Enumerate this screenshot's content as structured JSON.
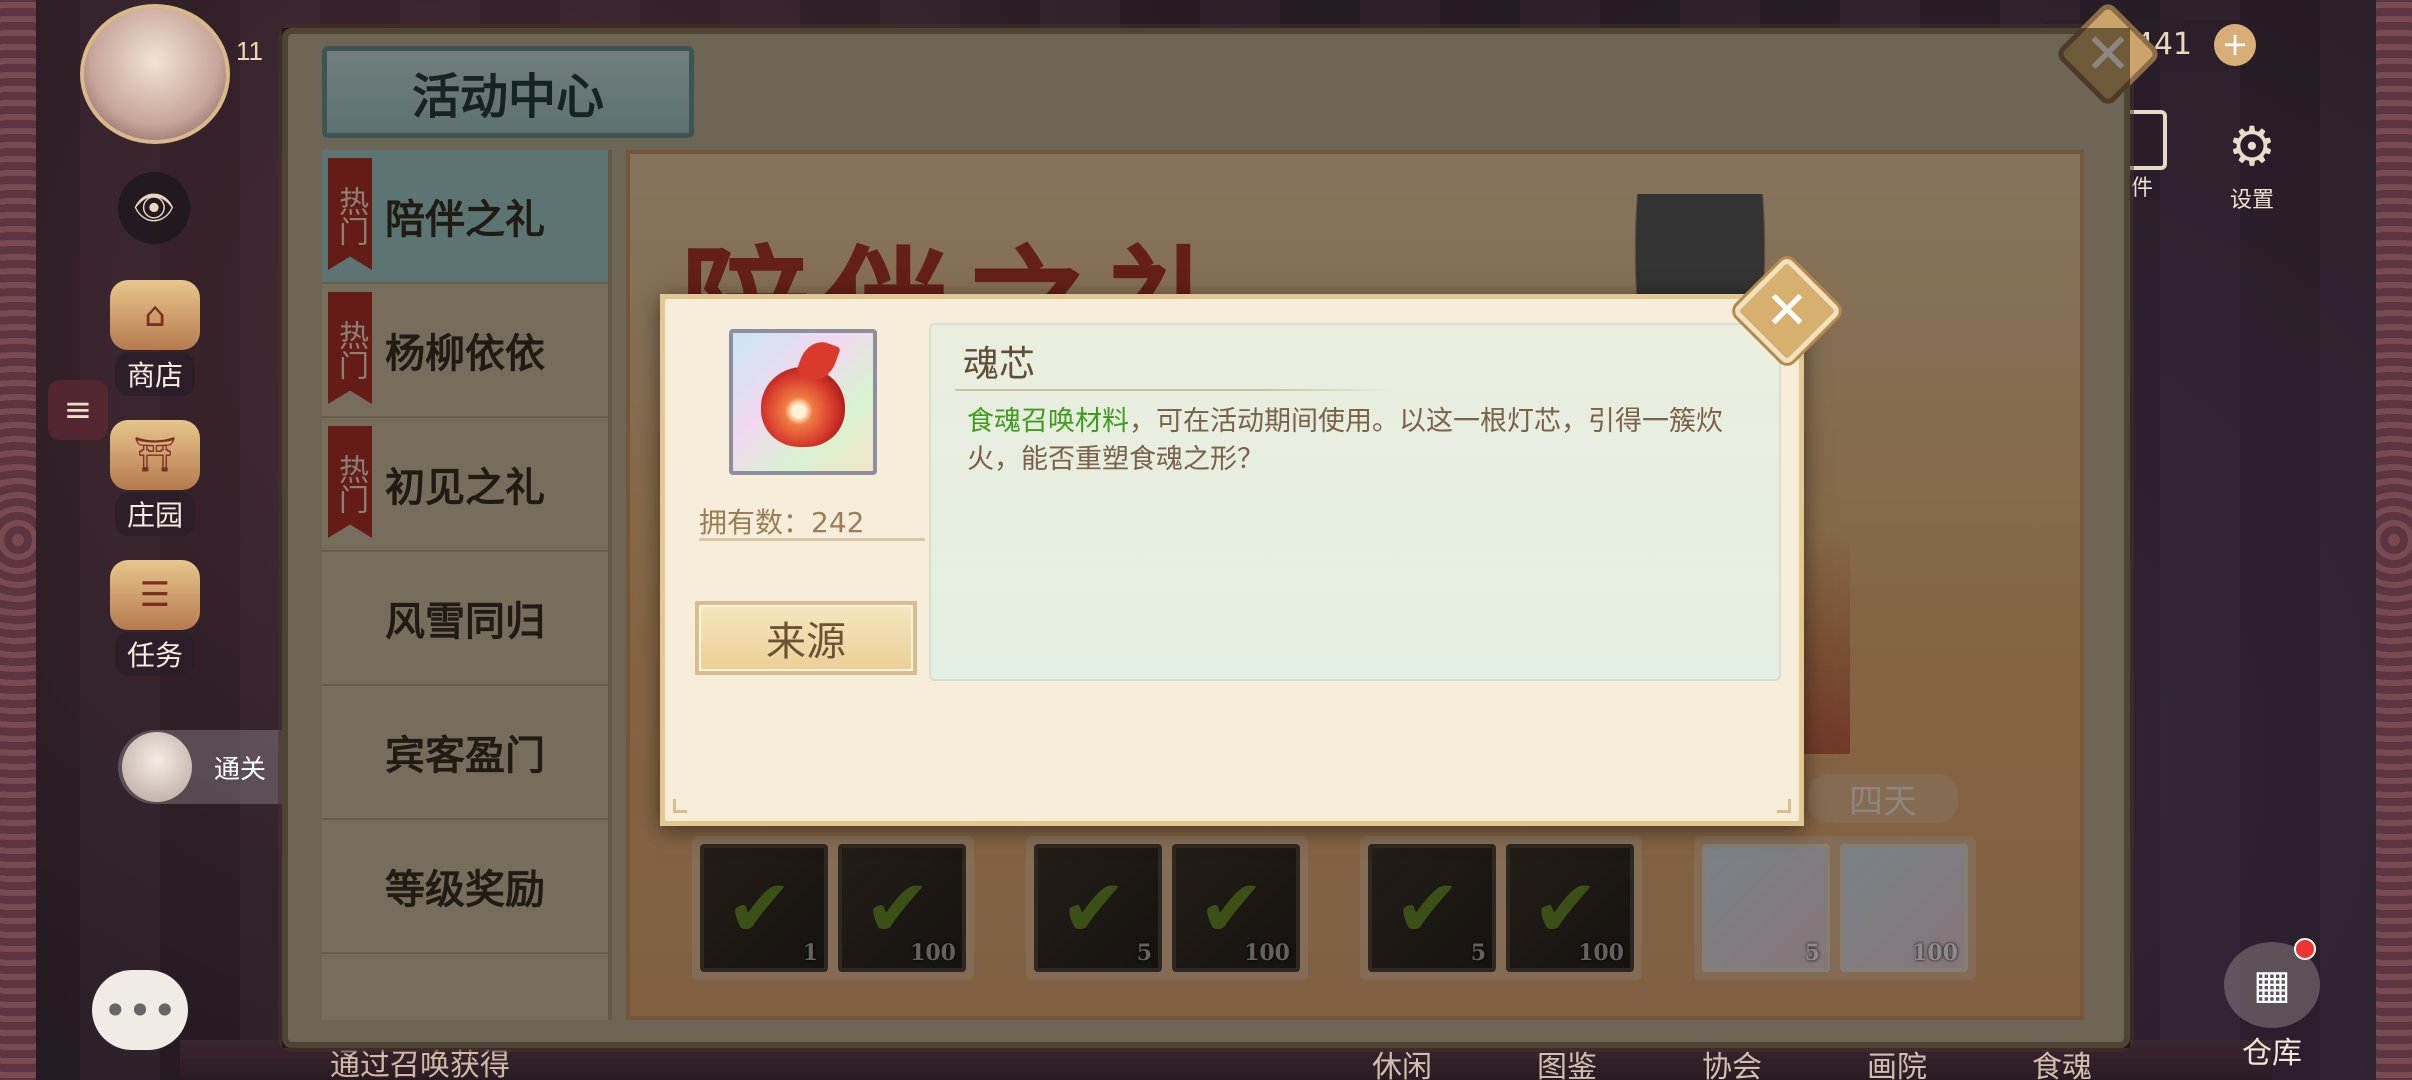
{
  "hud": {
    "level": "11",
    "resource_value": "441",
    "plus_symbol": "+",
    "settings_label": "设置",
    "mail_label": "件",
    "side_buttons": [
      {
        "label": "商店"
      },
      {
        "label": "庄园"
      },
      {
        "label": "任务"
      }
    ],
    "friend_label": "通关",
    "hint_text": "通过召唤获得",
    "bottom_tabs": [
      "休闲",
      "图鉴",
      "协会",
      "画院",
      "食魂"
    ],
    "warehouse_label": "仓库"
  },
  "activity_center": {
    "title": "活动中心",
    "close_symbol": "✕",
    "tabs": [
      {
        "label": "陪伴之礼",
        "hot": "热门",
        "active": true
      },
      {
        "label": "杨柳依依",
        "hot": "热门"
      },
      {
        "label": "初见之礼",
        "hot": "热门"
      },
      {
        "label": "风雪同归"
      },
      {
        "label": "宾客盈门"
      },
      {
        "label": "等级奖励"
      }
    ],
    "banner_title": "陪伴之礼",
    "day_label": "四天",
    "reward_groups": [
      {
        "items": [
          {
            "count": "1",
            "claimed": true
          },
          {
            "count": "100",
            "claimed": true
          }
        ]
      },
      {
        "items": [
          {
            "count": "5",
            "claimed": true
          },
          {
            "count": "100",
            "claimed": true
          }
        ]
      },
      {
        "items": [
          {
            "count": "5",
            "claimed": true
          },
          {
            "count": "100",
            "claimed": true
          }
        ]
      },
      {
        "items": [
          {
            "count": "5",
            "claimed": false
          },
          {
            "count": "100",
            "claimed": false
          }
        ]
      }
    ]
  },
  "item_popup": {
    "name": "魂芯",
    "own_label": "拥有数：242",
    "source_button": "来源",
    "desc_highlight": "食魂召唤材料",
    "desc_rest": "，可在活动期间使用。以这一根灯芯，引得一簇炊火，能否重塑食魂之形？",
    "close_symbol": "✕",
    "icon": "soul-core-flame-icon"
  }
}
